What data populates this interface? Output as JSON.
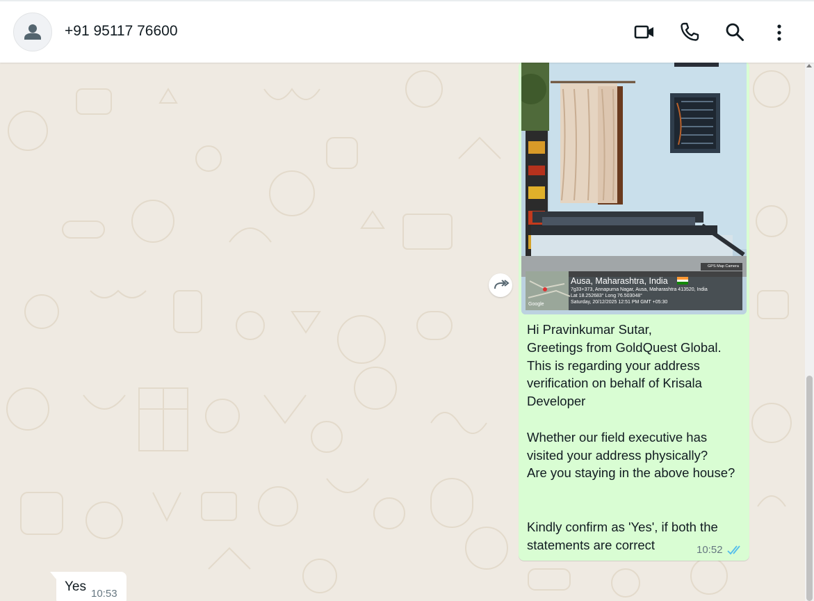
{
  "header": {
    "contact_name": "+91 95117 76600",
    "icons": [
      "person-icon",
      "video-call-icon",
      "voice-call-icon",
      "search-icon",
      "menu-icon"
    ]
  },
  "photo_overlay": {
    "location_title": "Ausa, Maharashtra, India",
    "address_line": "7g33+373, Annapurna Nagar, Ausa, Maharashtra 413520, India",
    "coords_line": "Lat 18.252683° Long 76.503048°",
    "datetime_line": "Saturday, 20/12/2025 12:51 PM GMT +05:30",
    "camera_brand": "GPS Map Camera",
    "map_brand": "Google"
  },
  "outgoing_message": {
    "text": "Hi Pravinkumar Sutar,\nGreetings from GoldQuest Global.\nThis is regarding your address verification on behalf of Krisala Developer\n\nWhether our field executive has visited your address physically?\nAre you staying in the above house?\n\n\nKindly confirm as 'Yes', if both the statements are correct",
    "time": "10:52",
    "status": "read"
  },
  "incoming_message": {
    "text": "Yes",
    "time": "10:53"
  },
  "colors": {
    "chat_background": "#efeae2",
    "outgoing_bubble": "#d9fdd3",
    "incoming_bubble": "#ffffff",
    "read_ticks": "#53bdeb"
  }
}
